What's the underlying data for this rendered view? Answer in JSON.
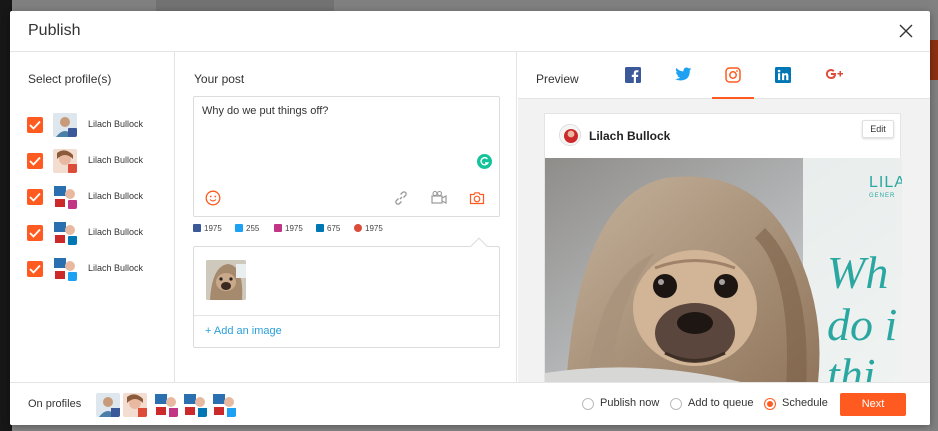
{
  "modal": {
    "title": "Publish"
  },
  "profiles": {
    "heading": "Select profile(s)",
    "items": [
      {
        "name": "Lilach Bullock",
        "network": "facebook",
        "checked": true
      },
      {
        "name": "Lilach Bullock",
        "network": "google-plus",
        "checked": true
      },
      {
        "name": "Lilach Bullock",
        "network": "instagram",
        "checked": true
      },
      {
        "name": "Lilach Bullock",
        "network": "linkedin",
        "checked": true
      },
      {
        "name": "Lilach Bullock",
        "network": "twitter",
        "checked": true
      }
    ]
  },
  "post": {
    "heading": "Your post",
    "text": "Why do we put things off?",
    "counts": {
      "facebook": "1975",
      "twitter": "255",
      "instagram": "1975",
      "linkedin": "675",
      "google_plus": "1975"
    },
    "add_image_label": "+ Add an image"
  },
  "preview": {
    "heading": "Preview",
    "tabs": [
      "facebook",
      "twitter",
      "instagram",
      "linkedin",
      "google-plus"
    ],
    "active_tab": "instagram",
    "user_name": "Lilach Bullock",
    "edit_label": "Edit",
    "image_overlay_brand": "LILA",
    "image_overlay_brand_sub": "GENER",
    "image_overlay_lines": [
      "Wh",
      "do i",
      "thi"
    ]
  },
  "footer": {
    "on_profiles_label": "On profiles",
    "options": [
      {
        "label": "Publish now",
        "selected": false
      },
      {
        "label": "Add to queue",
        "selected": false
      },
      {
        "label": "Schedule",
        "selected": true
      }
    ],
    "next_label": "Next"
  },
  "colors": {
    "accent": "#ff5a1f",
    "facebook": "#3b5998",
    "twitter": "#1da1f2",
    "instagram": "#c13584",
    "linkedin": "#0077b5",
    "google_plus": "#dd4b39",
    "link": "#2a9fd8"
  }
}
